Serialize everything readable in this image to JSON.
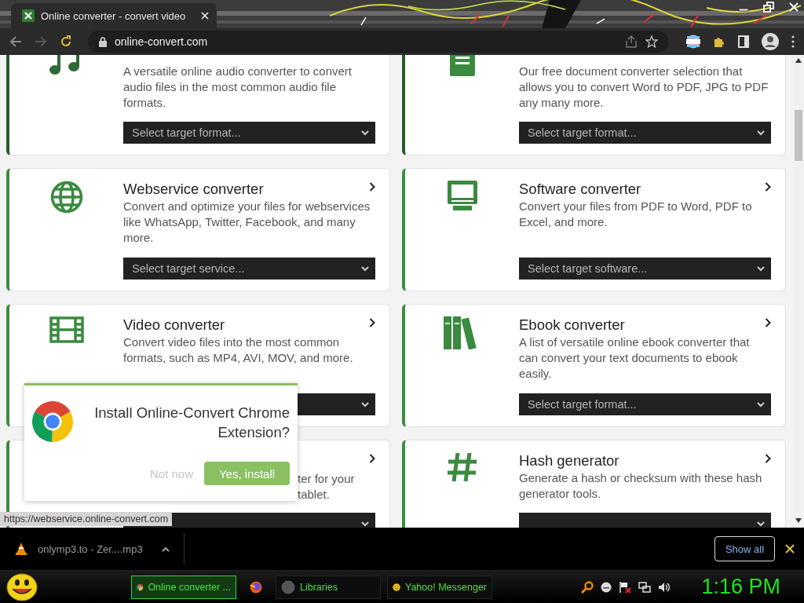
{
  "browser": {
    "tab_title": "Online converter - convert video",
    "url": "online-convert.com"
  },
  "cards": [
    {
      "kind": "card",
      "icon": {
        "kind": "notes"
      },
      "arrow": false,
      "description": "A versatile online audio converter to convert audio files in the most common audio file formats.",
      "select": {
        "placeholder": "Select target format..."
      }
    },
    {
      "kind": "card",
      "icon": {
        "kind": "document"
      },
      "arrow": false,
      "description": "Our free document converter selection that allows you to convert Word to PDF, JPG to PDF any many more.",
      "select": {
        "placeholder": "Select target format..."
      }
    },
    {
      "kind": "card",
      "icon": {
        "kind": "globe"
      },
      "arrow": true,
      "title": "Webservice converter",
      "description": "Convert and optimize your files for webservices like WhatsApp, Twitter, Facebook, and many more.",
      "select": {
        "placeholder": "Select target service..."
      }
    },
    {
      "kind": "card",
      "icon": {
        "kind": "monitor"
      },
      "arrow": true,
      "title": "Software converter",
      "description": "Convert your files from PDF to Word, PDF to Excel, and more.",
      "select": {
        "placeholder": "Select target software..."
      }
    },
    {
      "kind": "card",
      "icon": {
        "kind": "film"
      },
      "arrow": true,
      "title": "Video converter",
      "description": "Convert video files into the most common formats, such as MP4, AVI, MOV, and more."
    },
    {
      "kind": "card",
      "icon": {
        "kind": "books"
      },
      "arrow": true,
      "title": "Ebook converter",
      "description": "A list of versatile online ebook converter that can convert your text documents to ebook easily.",
      "select": {
        "placeholder": "Select target format..."
      }
    },
    {
      "kind": "covered",
      "arrow": true,
      "description": "ter for your tablet."
    },
    {
      "kind": "card",
      "icon": {
        "kind": "hash"
      },
      "arrow": true,
      "title": "Hash generator",
      "description": "Generate a hash or checksum with these hash generator tools."
    }
  ],
  "popup": {
    "title": "Install Online-Convert Chrome Extension?",
    "dismiss": "Not now",
    "confirm": "Yes, install"
  },
  "status_tooltip": "https://webservice.online-convert.com",
  "download_bar": {
    "file": "onlymp3.to - Zer....mp3",
    "show_all": "Show all"
  },
  "taskbar": {
    "tasks": [
      {
        "icon": {
          "kind": "chrome"
        },
        "label": "Online converter ...",
        "selected": true
      },
      {
        "icon": {
          "kind": "firefox"
        },
        "selected": false
      },
      {
        "icon": {
          "kind": "disc"
        },
        "label": "Libraries",
        "selected": false
      },
      {
        "icon": {
          "kind": "smiley"
        },
        "label": "Yahoo! Messenger",
        "selected": false
      }
    ],
    "clock": "1:16 PM"
  }
}
